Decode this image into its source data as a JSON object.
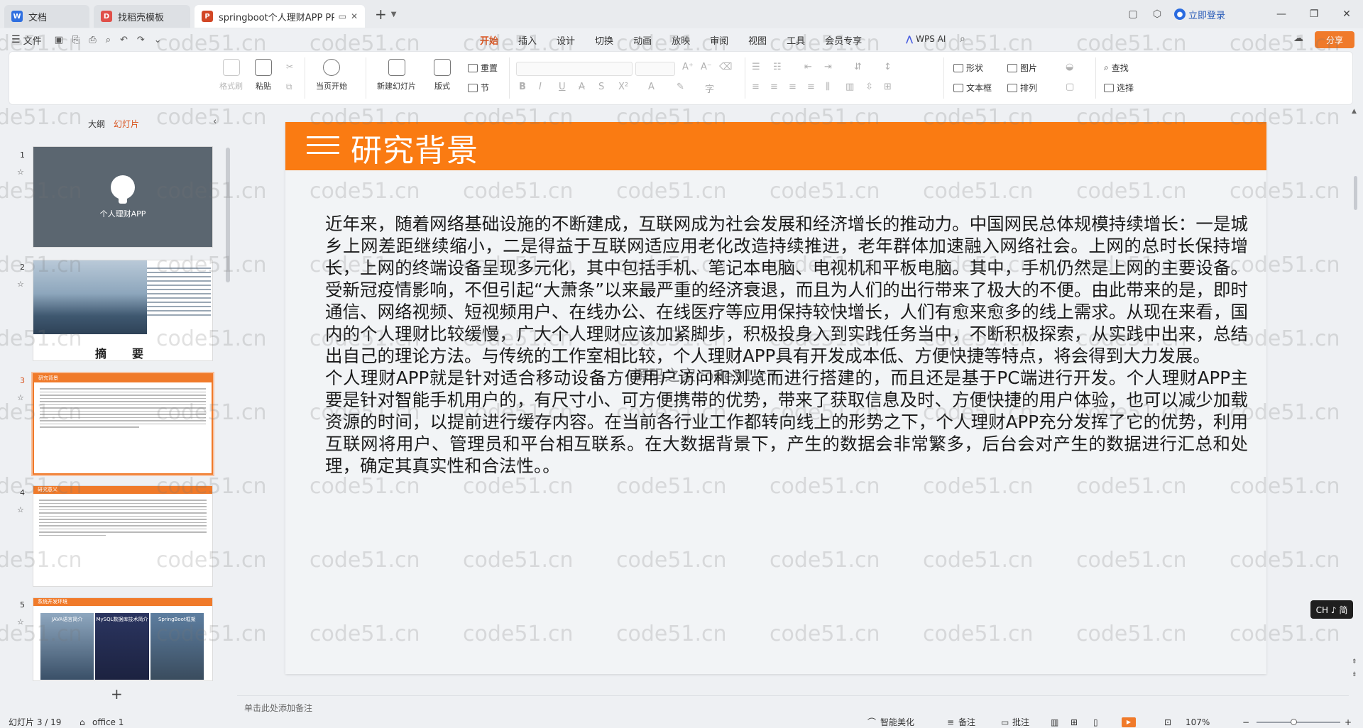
{
  "tabs": [
    {
      "label": "文档",
      "icon": "docs-icon"
    },
    {
      "label": "找稻壳模板",
      "icon": "docer-icon"
    },
    {
      "label": "springboot个人理财APP PPT",
      "icon": "ppt-icon"
    }
  ],
  "titlebar": {
    "login_label": "立即登录"
  },
  "menubar": {
    "file_label": "文件",
    "menus": [
      "开始",
      "插入",
      "设计",
      "切换",
      "动画",
      "放映",
      "审阅",
      "视图",
      "工具",
      "会员专享"
    ],
    "active_menu": "开始",
    "wps_ai_label": "WPS AI",
    "share_label": "分享"
  },
  "ribbon": {
    "format_painter": "格式刷",
    "paste": "粘贴",
    "play_from_start": "当页开始",
    "new_slide": "新建幻灯片",
    "layout": "版式",
    "reset": "重置",
    "section": "节",
    "shape": "形状",
    "picture": "图片",
    "textbox": "文本框",
    "arrange": "排列",
    "find": "查找",
    "select": "选择"
  },
  "left_panel": {
    "tab_outline": "大纲",
    "tab_slides": "幻灯片",
    "active_tab": "幻灯片",
    "thumbnails": [
      {
        "number": "1",
        "title": "个人理财APP"
      },
      {
        "number": "2",
        "title": "摘　要"
      },
      {
        "number": "3",
        "title": "研究背景"
      },
      {
        "number": "4",
        "title": "研究意义"
      },
      {
        "number": "5",
        "title": "系统开发环境",
        "images": [
          "JAVA语言简介",
          "MySQL数据库技术简介",
          "SpringBoot框架"
        ]
      }
    ],
    "selected": "3"
  },
  "slide": {
    "title": "研究背景",
    "paragraphs": [
      "近年来，随着网络基础设施的不断建成，互联网成为社会发展和经济增长的推动力。中国网民总体规模持续增长：一是城乡上网差距继续缩小，二是得益于互联网适应用老化改造持续推进，老年群体加速融入网络社会。上网的总时长保持增长，上网的终端设备呈现多元化，其中包括手机、笔记本电脑、电视机和平板电脑。其中，手机仍然是上网的主要设备。受新冠疫情影响，不但引起“大萧条”以来最严重的经济衰退，而且为人们的出行带来了极大的不便。由此带来的是，即时通信、网络视频、短视频用户、在线办公、在线医疗等应用保持较快增长，人们有愈来愈多的线上需求。从现在来看，国内的个人理财比较缓慢，广大个人理财应该加紧脚步，积极投身入到实践任务当中，不断积极探索，从实践中出来，总结出自己的理论方法。与传统的工作室相比较，个人理财APP具有开发成本低、方便快捷等特点，将会得到大力发展。",
      "个人理财APP就是针对适合移动设备方便用户访问和浏览而进行搭建的，而且还是基于PC端进行开发。个人理财APP主要是针对智能手机用户的，有尺寸小、可方便携带的优势，带来了获取信息及时、方便快捷的用户体验，也可以减少加载资源的时间，以提前进行缓存内容。在当前各行业工作都转向线上的形势之下，个人理财APP充分发挥了它的优势，利用互联网将用户、管理员和平台相互联系。在大数据背景下，产生的数据会非常繁多，后台会对产生的数据进行汇总和处理，确定其真实性和合法性。。"
    ],
    "overlay_text": "源码之家code51.cn"
  },
  "notes_placeholder": "单击此处添加备注",
  "ime_badge": "CH ♪ 简",
  "statusbar": {
    "slide_counter": "幻灯片 3 / 19",
    "theme": "office 1",
    "smart_beautify": "智能美化",
    "notes": "备注",
    "comments": "批注",
    "zoom": "107%"
  },
  "watermark": "code51.cn",
  "colors": {
    "accent": "#fa7b12",
    "menu_active": "#d9531e",
    "share": "#f07a2a"
  }
}
